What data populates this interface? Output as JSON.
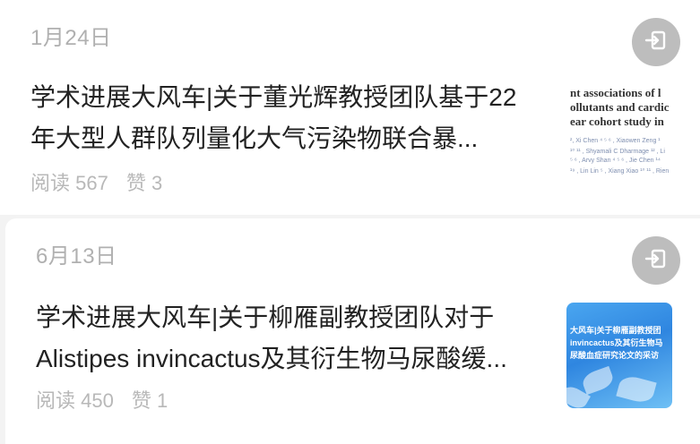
{
  "articles": [
    {
      "date": "1月24日",
      "title": "学术进展大风车|关于董光辉教授团队基于22年大型人群队列量化大气污染物联合暴...",
      "reads": "阅读 567",
      "likes": "赞 3",
      "thumb_lines": [
        "nt associations of l",
        "ollutants and cardic",
        "ear cohort study in"
      ],
      "thumb_small": [
        "², Xi Chen ⁴ ⁵ ⁶ , Xiaowen Zeng ¹",
        "¹⁰ ¹¹ , Shyamali C Dharmage ¹² , Li",
        "⁵ ⁶ , Arvy Shan ⁴ ⁵ ⁶ , Jie Chen ¹⁴",
        "¹⁹ , Lin Lin ⁵ , Xiang Xiao ¹⁰ ¹¹ , Rien"
      ]
    },
    {
      "date": "6月13日",
      "title": "学术进展大风车|关于柳雁副教授团队对于Alistipes invincactus及其衍生物马尿酸缓...",
      "reads": "阅读 450",
      "likes": "赞 1",
      "thumb_lines": [
        "大风车|关于柳雁副教授团",
        "invincactus及其衍生物马",
        "尿酸血症研究论文的采访"
      ]
    }
  ],
  "icons": {
    "action": "exit-to-app-icon"
  },
  "colors": {
    "date": "#b0b0b0",
    "title": "#222222",
    "meta": "#b8b8b8",
    "button": "#bdbdbd",
    "thumb_blue": "#2f86e0"
  }
}
